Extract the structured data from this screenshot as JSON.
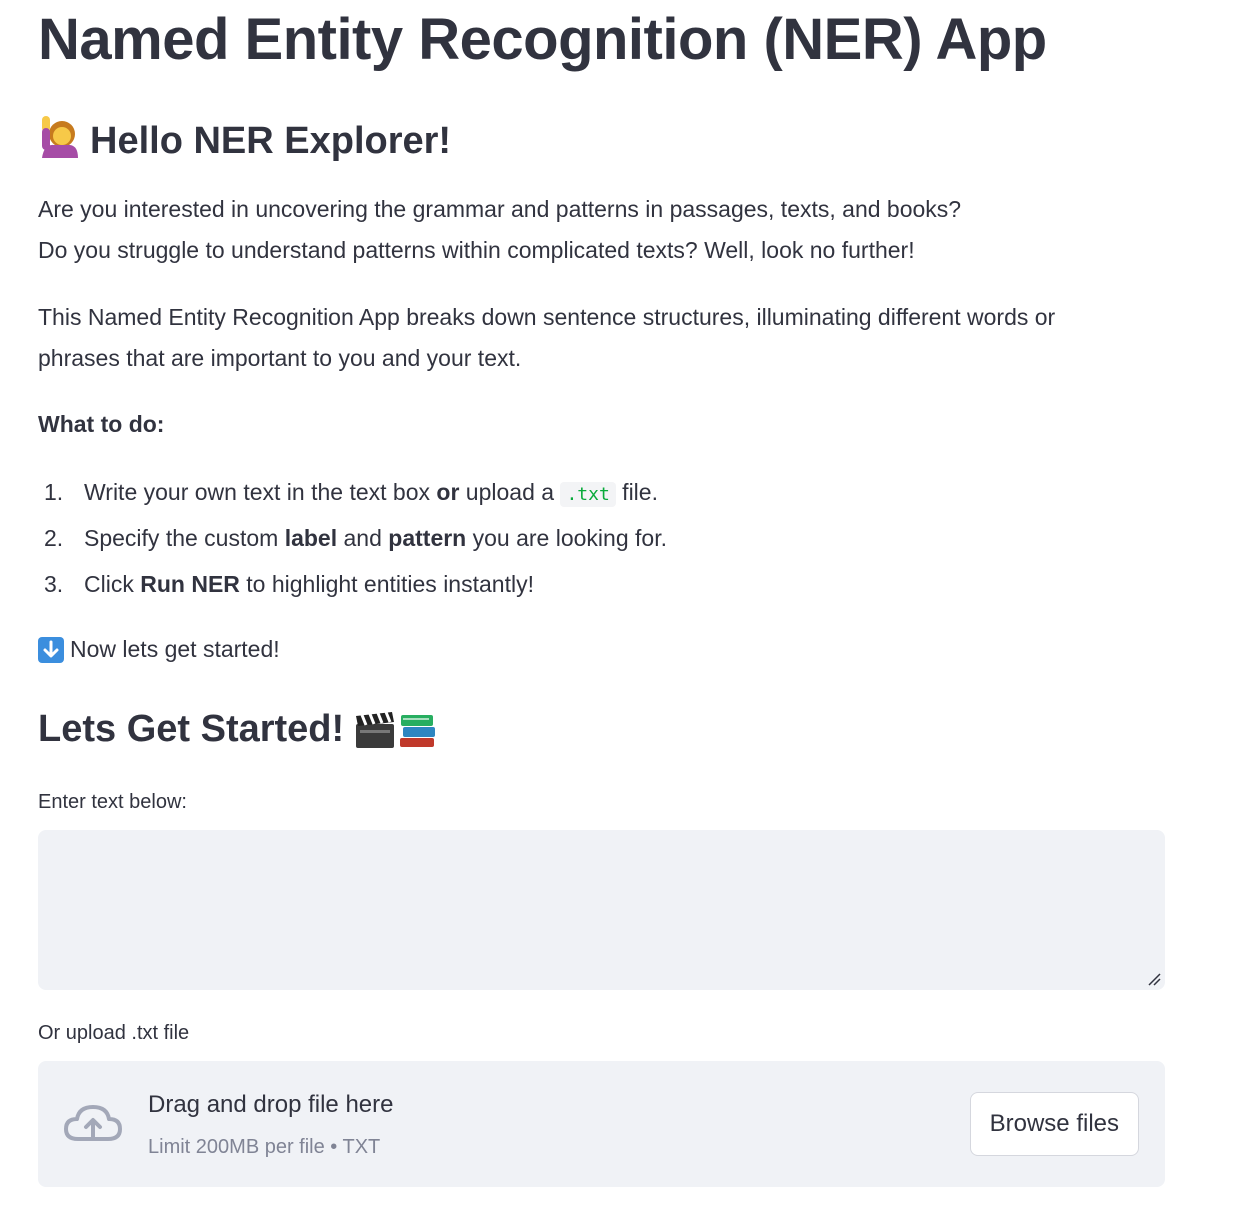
{
  "header": {
    "title": "Named Entity Recognition (NER) App",
    "greeting": "Hello NER Explorer!"
  },
  "intro": {
    "line1": "Are you interested in uncovering the grammar and patterns in passages, texts, and books?",
    "line2": "Do you struggle to understand patterns within complicated texts? Well, look no further!",
    "desc_line1": "This Named Entity Recognition App breaks down sentence structures, illuminating different words or",
    "desc_line2": "phrases that are important to you and your text."
  },
  "instructions": {
    "heading": "What to do:",
    "steps": [
      {
        "num": "1.",
        "part_a": "Write your own text in the text box ",
        "bold_a": "or",
        "part_b": " upload a ",
        "code": ".txt",
        "part_c": " file."
      },
      {
        "num": "2.",
        "part_a": "Specify the custom ",
        "bold_a": "label",
        "part_b": " and ",
        "bold_b": "pattern",
        "part_c": " you are looking for."
      },
      {
        "num": "3.",
        "part_a": "Click ",
        "bold_a": "Run NER",
        "part_b": " to highlight entities instantly!"
      }
    ],
    "start_note": "Now lets get started!"
  },
  "section": {
    "title": "Lets Get Started!"
  },
  "text_input": {
    "label": "Enter text below:",
    "value": "",
    "placeholder": ""
  },
  "uploader": {
    "label": "Or upload .txt file",
    "drag_text": "Drag and drop file here",
    "limit_text": "Limit 200MB per file • TXT",
    "browse_label": "Browse files"
  },
  "icons": {
    "greeting": "person-raising-hand-icon",
    "start_note": "down-arrow-icon",
    "section": "clapper-board-icon",
    "section_2": "books-icon",
    "upload": "cloud-upload-icon"
  },
  "colors": {
    "text": "#31333f",
    "muted": "#808495",
    "panel_bg": "#f0f2f6",
    "code": "#09ab3b"
  }
}
